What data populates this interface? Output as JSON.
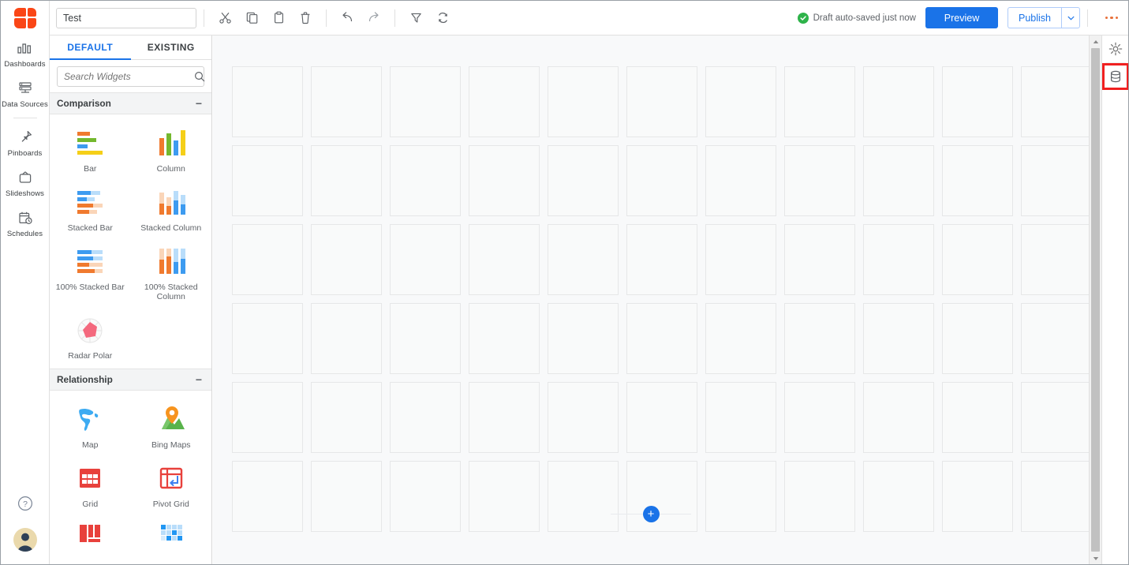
{
  "app": {
    "logo_name": "app-logo",
    "accent_blue": "#1a73e8",
    "brand_orange": "#fa4616",
    "highlight_red": "#f02020"
  },
  "rail": {
    "items": [
      {
        "label": "Dashboards",
        "icon": "bar-chart-icon"
      },
      {
        "label": "Data Sources",
        "icon": "database-stack-icon"
      },
      {
        "label": "Pinboards",
        "icon": "pin-icon"
      },
      {
        "label": "Slideshows",
        "icon": "tv-icon"
      },
      {
        "label": "Schedules",
        "icon": "calendar-clock-icon"
      }
    ],
    "help_label": "help-icon",
    "avatar_label": "user-avatar"
  },
  "topbar": {
    "title_value": "Test",
    "title_placeholder": "Dashboard name",
    "tools": [
      {
        "name": "cut-button",
        "icon": "scissors-icon"
      },
      {
        "name": "copy-button",
        "icon": "copy-icon"
      },
      {
        "name": "paste-button",
        "icon": "clipboard-icon"
      },
      {
        "name": "delete-button",
        "icon": "trash-icon"
      },
      {
        "name": "undo-button",
        "icon": "undo-arrow-icon"
      },
      {
        "name": "redo-button",
        "icon": "redo-arrow-icon"
      },
      {
        "name": "filter-button",
        "icon": "funnel-icon"
      },
      {
        "name": "refresh-button",
        "icon": "refresh-icon"
      }
    ],
    "autosave_text": "Draft auto-saved just now",
    "preview_label": "Preview",
    "publish_label": "Publish",
    "more_label": "more-options"
  },
  "widget_panel": {
    "tabs": [
      {
        "label": "DEFAULT",
        "active": true
      },
      {
        "label": "EXISTING",
        "active": false
      }
    ],
    "search_value": "",
    "search_placeholder": "Search Widgets",
    "groups": [
      {
        "title": "Comparison",
        "collapse_glyph": "−",
        "items": [
          {
            "label": "Bar",
            "icon": "bar-chart-widget-icon"
          },
          {
            "label": "Column",
            "icon": "column-chart-widget-icon"
          },
          {
            "label": "Stacked Bar",
            "icon": "stacked-bar-widget-icon"
          },
          {
            "label": "Stacked Column",
            "icon": "stacked-column-widget-icon"
          },
          {
            "label": "100% Stacked Bar",
            "icon": "pct-stacked-bar-widget-icon"
          },
          {
            "label": "100% Stacked Column",
            "icon": "pct-stacked-column-widget-icon"
          },
          {
            "label": "Radar Polar",
            "icon": "radar-polar-widget-icon"
          }
        ]
      },
      {
        "title": "Relationship",
        "collapse_glyph": "−",
        "items": [
          {
            "label": "Map",
            "icon": "world-map-widget-icon"
          },
          {
            "label": "Bing Maps",
            "icon": "map-pin-widget-icon"
          },
          {
            "label": "Grid",
            "icon": "grid-widget-icon"
          },
          {
            "label": "Pivot Grid",
            "icon": "pivot-grid-widget-icon"
          },
          {
            "label": "",
            "icon": "treemap-widget-icon"
          },
          {
            "label": "",
            "icon": "heatmap-widget-icon"
          }
        ]
      }
    ]
  },
  "canvas": {
    "columns": 12,
    "rows": 6,
    "add_button_label": "+"
  },
  "right_rail": {
    "items": [
      {
        "name": "settings-button",
        "icon": "gear-icon",
        "highlighted": false
      },
      {
        "name": "data-button",
        "icon": "database-icon",
        "highlighted": true
      }
    ]
  },
  "scrollbar": {
    "up_glyph": "▲",
    "down_glyph": "▼"
  }
}
